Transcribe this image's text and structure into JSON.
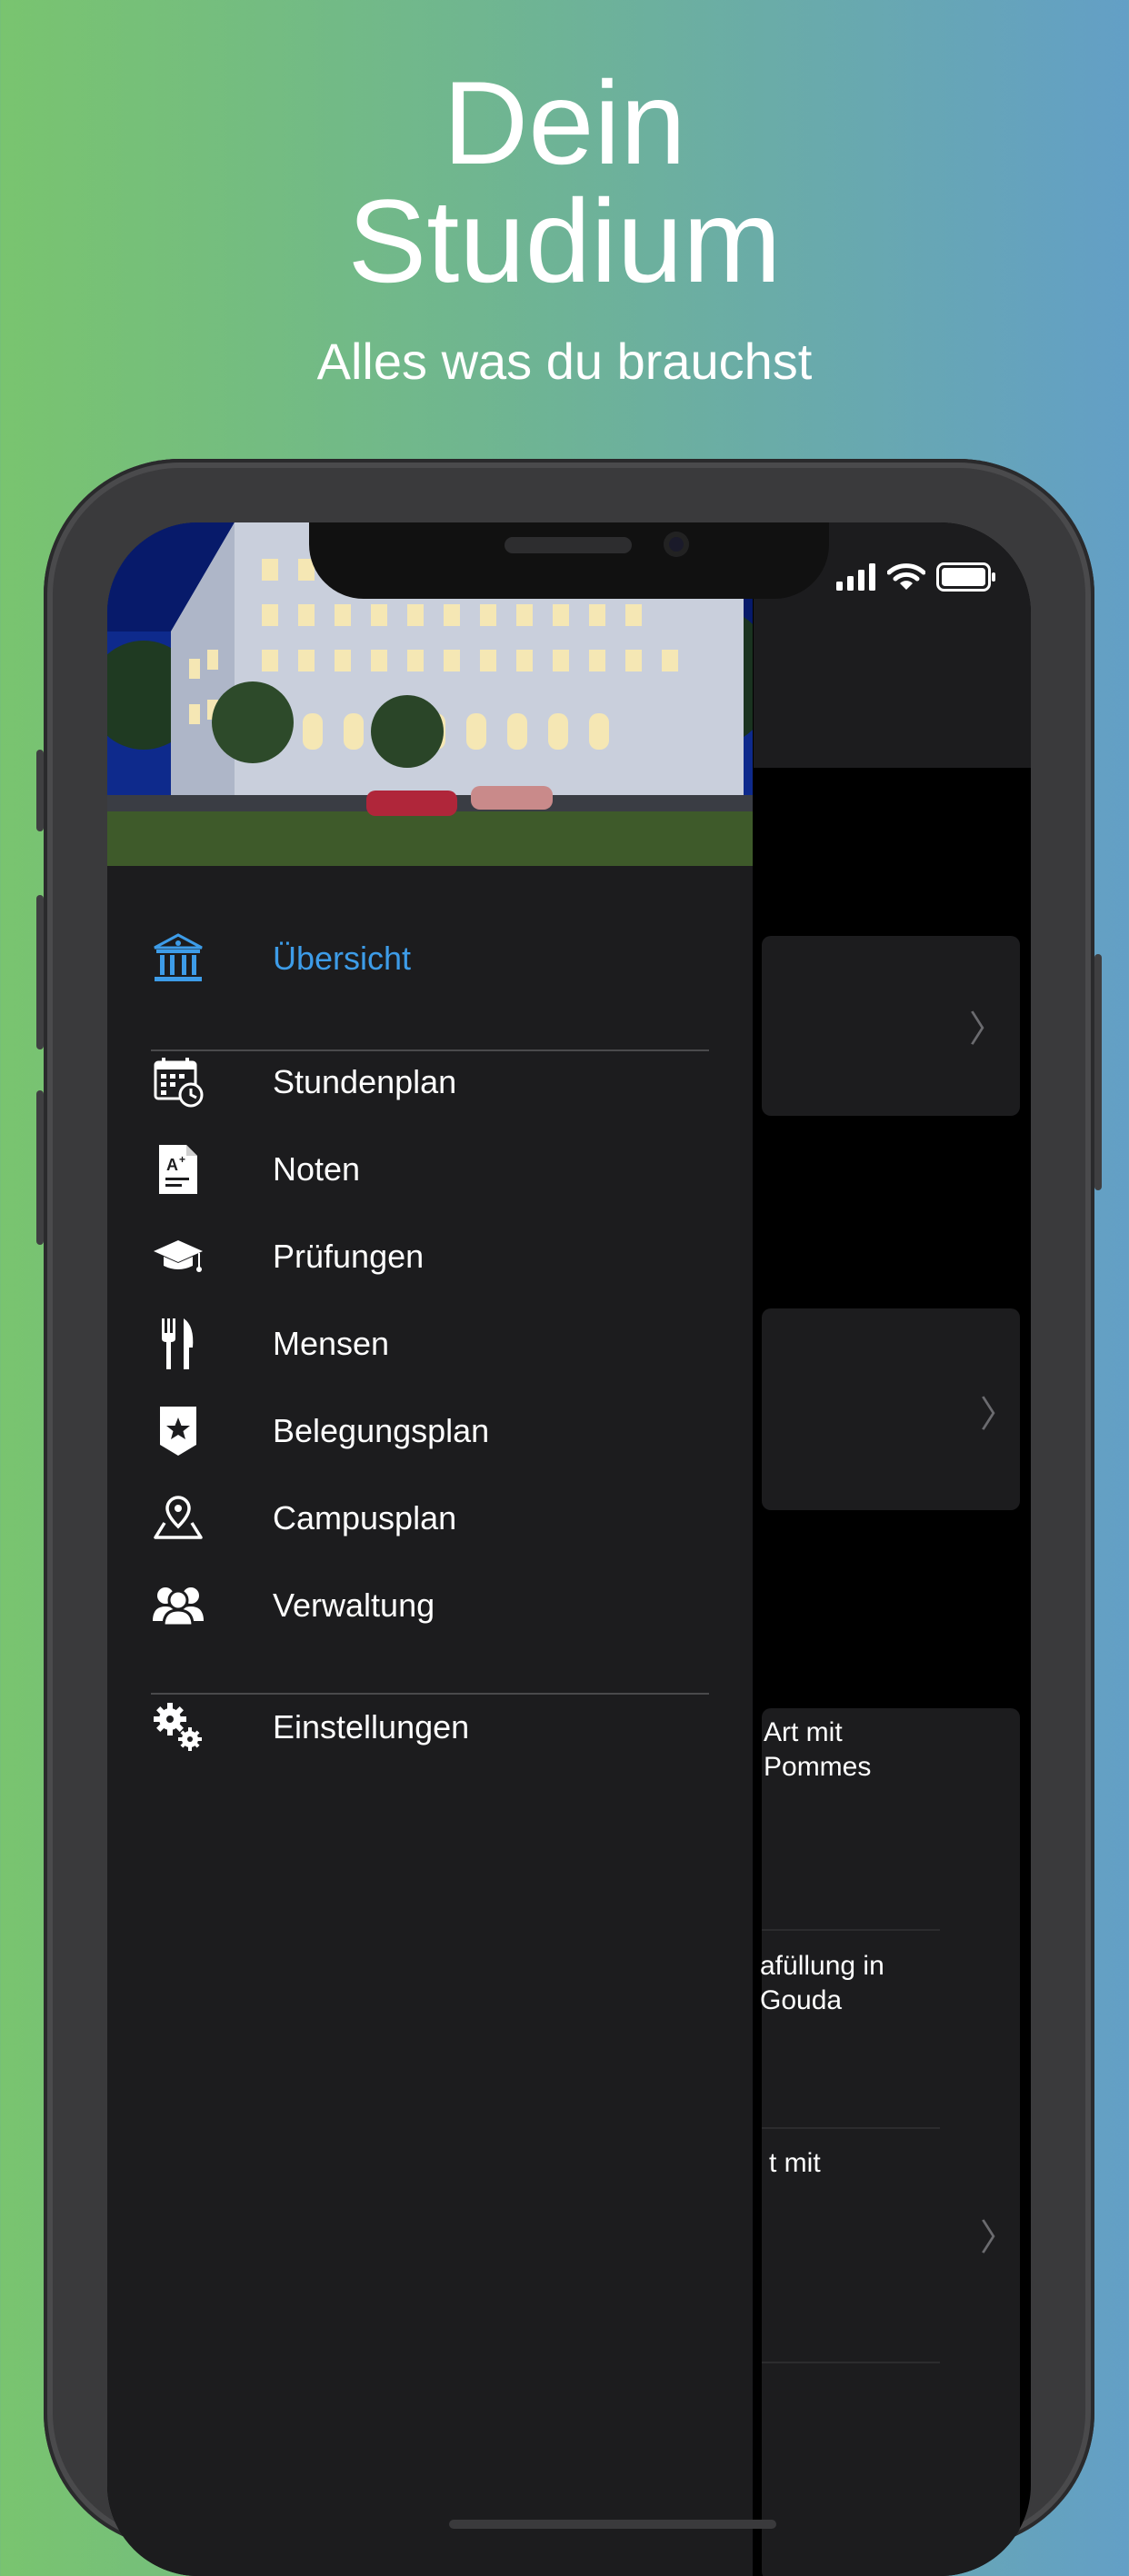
{
  "promo": {
    "title_line1": "Dein",
    "title_line2": "Studium",
    "subtitle": "Alles was du brauchst"
  },
  "background_list": {
    "item1_line1": "Art mit",
    "item1_line2": "Pommes",
    "item2_line1": "afüllung in",
    "item2_line2": "Gouda",
    "item3_line1": "t mit"
  },
  "menu": {
    "primary": {
      "label": "Übersicht",
      "icon": "university-building-icon",
      "color": "#3d9ce8"
    },
    "items": [
      {
        "label": "Stundenplan",
        "icon": "calendar-clock-icon"
      },
      {
        "label": "Noten",
        "icon": "grade-document-icon"
      },
      {
        "label": "Prüfungen",
        "icon": "graduation-cap-icon"
      },
      {
        "label": "Mensen",
        "icon": "fork-knife-icon"
      },
      {
        "label": "Belegungsplan",
        "icon": "star-badge-icon"
      },
      {
        "label": "Campusplan",
        "icon": "map-pin-icon"
      },
      {
        "label": "Verwaltung",
        "icon": "people-icon"
      }
    ],
    "settings": {
      "label": "Einstellungen",
      "icon": "gears-icon"
    }
  },
  "colors": {
    "drawer_bg": "#1c1c1e",
    "accent": "#3d9ce8",
    "gradient_left": "#79c46f",
    "gradient_right": "#639fc6"
  }
}
